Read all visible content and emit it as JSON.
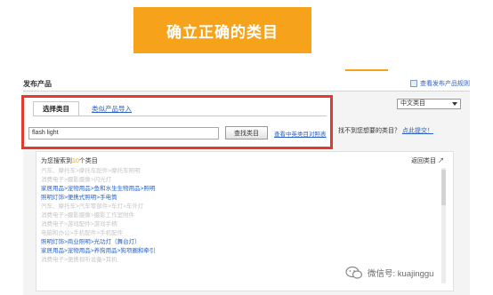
{
  "banner": {
    "title": "确立正确的类目"
  },
  "header": {
    "page_title": "发布产品",
    "view_products_link": "查看发布产品规则"
  },
  "tabs": [
    {
      "label": "选择类目",
      "active": true
    },
    {
      "label": "类似产品导入",
      "active": false
    }
  ],
  "search": {
    "value": "flash light",
    "button_label": "查找类目",
    "compare_link": "查看中英类目对照表"
  },
  "language_select": {
    "selected": "中文类目"
  },
  "help": {
    "question": "找不到您想要的类目？",
    "link": "点此提交！"
  },
  "results": {
    "found_prefix": "为您搜索到",
    "found_count": "10",
    "found_suffix": "个类目",
    "back_label": "返回类目",
    "items": [
      {
        "text": "汽车、摩托车>摩托车配件>摩托车照明",
        "style": "faint"
      },
      {
        "text": "消费电子>摄影摄像>闪光灯",
        "style": "faint"
      },
      {
        "text": "家居用品>宠物用品>鱼和水生生物用品>照明",
        "style": "blue"
      },
      {
        "text": "照明灯饰>便携式照明>手电筒",
        "style": "blue"
      },
      {
        "text": "汽车、摩托车>汽车零部件>车灯>车外灯",
        "style": "faint"
      },
      {
        "text": "消费电子>摄影摄像>摄影工作室附件",
        "style": "faint"
      },
      {
        "text": "消费电子>游戏配件>游戏手柄",
        "style": "faint"
      },
      {
        "text": "电脑和办公>手机配件>手机配件",
        "style": "faint"
      },
      {
        "text": "照明灯饰>商业照明>光功灯（舞台灯）",
        "style": "blue"
      },
      {
        "text": "家居用品>宠物用品>养狗用品>狗项圈和牵引",
        "style": "blue"
      },
      {
        "text": "消费电子>便携视听设备>耳机",
        "style": "faint"
      }
    ]
  },
  "watermark": {
    "text": "微信号: kuajinggu"
  },
  "colors": {
    "banner": "#f7a21b",
    "highlight_border": "#e23b2e",
    "link": "#2a62c9",
    "count": "#f7a21b"
  },
  "icons": [
    "view-products-icon",
    "dropdown-arrow-icon",
    "back-arrow-icon",
    "wechat-icon",
    "scrollbar-thumb"
  ]
}
